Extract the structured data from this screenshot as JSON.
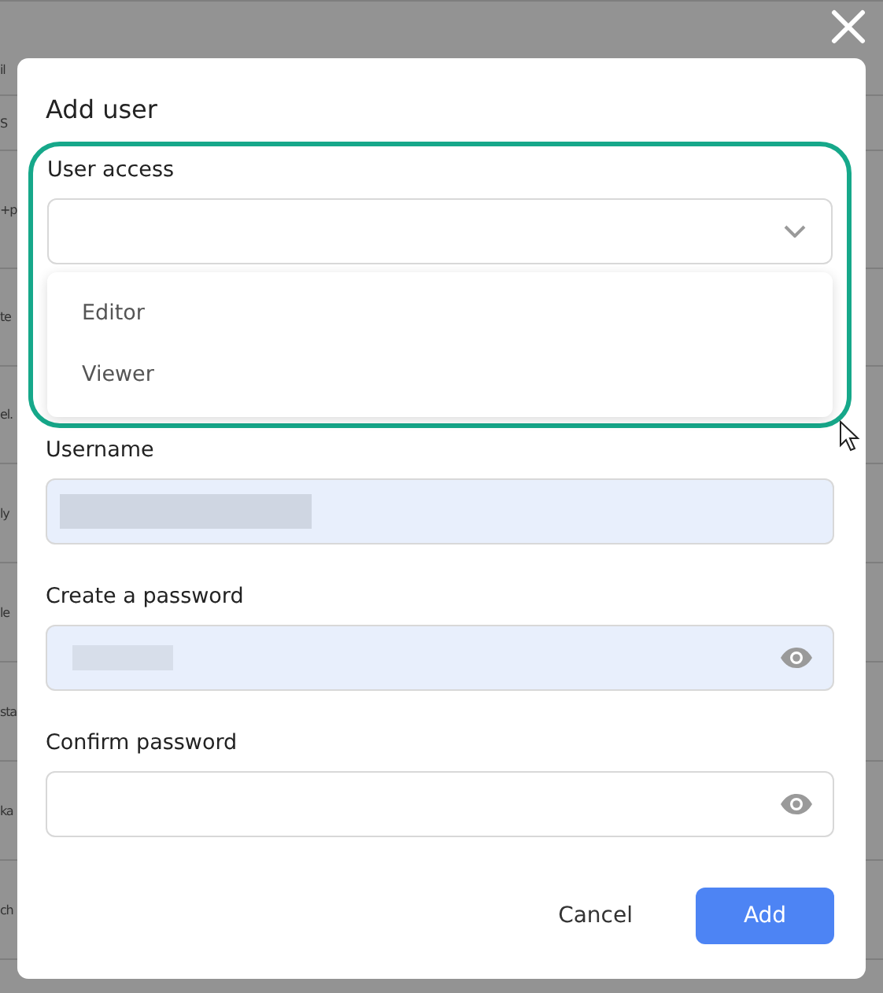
{
  "backdrop": {
    "row_fragments": [
      "il",
      "S",
      "+p",
      "te",
      "el.",
      "ly",
      "le",
      "sta",
      "ka",
      "ch"
    ]
  },
  "dialog": {
    "title": "Add user",
    "fields": [
      {
        "kind": "select",
        "label": "User access",
        "highlighted": true,
        "open": true,
        "options": [
          {
            "label": "Editor",
            "selected": false
          },
          {
            "label": "Viewer",
            "selected": false
          }
        ]
      },
      {
        "kind": "text",
        "label": "Username",
        "filled": true
      },
      {
        "kind": "password",
        "label": "Create a password",
        "filled": true
      },
      {
        "kind": "password",
        "label": "Confirm password",
        "filled": false
      }
    ],
    "buttons": [
      {
        "kind": "text",
        "label": "Cancel"
      },
      {
        "kind": "primary",
        "label": "Add"
      }
    ]
  }
}
